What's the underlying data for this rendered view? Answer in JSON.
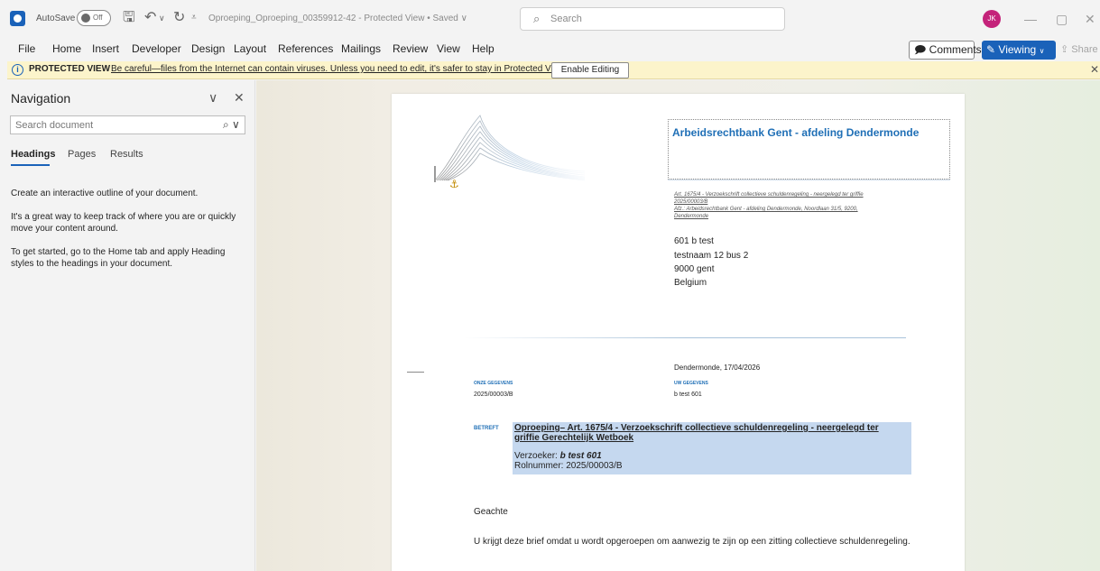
{
  "titlebar": {
    "autosave_label": "AutoSave",
    "autosave_state": "Off",
    "document_title": "Oproeping_Oproeping_00359912-42 - Protected View • Saved ∨",
    "search_placeholder": "Search",
    "user_initials": "JK"
  },
  "menu": {
    "items": [
      "File",
      "Home",
      "Insert",
      "Developer",
      "Design",
      "Layout",
      "References",
      "Mailings",
      "Review",
      "View",
      "Help"
    ],
    "comments_label": "Comments",
    "viewing_label": "Viewing",
    "share_label": "Share"
  },
  "protected_view": {
    "title": "PROTECTED VIEW",
    "message": "Be careful—files from the Internet can contain viruses. Unless you need to edit, it's safer to stay in Protected View.",
    "button_label": "Enable Editing"
  },
  "navigation": {
    "title": "Navigation",
    "search_placeholder": "Search document",
    "tabs": [
      "Headings",
      "Pages",
      "Results"
    ],
    "active_tab": "Headings",
    "paragraphs": [
      "Create an interactive outline of your document.",
      "It's a great way to keep track of where you are or quickly move your content around.",
      "To get started, go to the Home tab and apply Heading styles to the headings in your document."
    ]
  },
  "document": {
    "court_name": "Arbeidsrechtbank Gent - afdeling Dendermonde",
    "reference_lines": [
      "Art. 1675/4 - Verzoekschrift collectieve schuldenregeling - neergelegd ter griffie",
      "2025/00003/B",
      "Afz.: Arbeidsrechtbank Gent - afdeling Dendermonde, Noordlaan 31/5, 9200,",
      "Dendermonde"
    ],
    "address_lines": [
      "601 b test",
      "testnaam 12 bus 2",
      "9000 gent",
      "Belgium"
    ],
    "place_date": "Dendermonde, 17/04/2026",
    "onze_label": "ONZE GEGEVENS",
    "onze_value": "2025/00003/B",
    "uw_label": "UW GEGEVENS",
    "uw_value": "b test 601",
    "betreft_label": "BETREFT",
    "subject": "Oproeping– Art. 1675/4 - Verzoekschrift collectieve schuldenregeling - neergelegd ter griffie  Gerechtelijk Wetboek",
    "verzoeker_label": "Verzoeker: ",
    "verzoeker_value": "b test 601",
    "rolnummer": "Rolnummer: 2025/00003/B",
    "salutation": "Geachte",
    "body": "U krijgt deze brief omdat u wordt opgeroepen om aanwezig te zijn op een zitting collectieve schuldenregeling."
  },
  "colors": {
    "accent": "#1a62b9",
    "court_blue": "#1f6fb6",
    "highlight": "#c5d8ef",
    "protected_bar": "#fcf4cb",
    "avatar": "#c4237a"
  },
  "icons": {
    "app": "outlook-icon",
    "save": "save-icon",
    "undo": "undo-icon",
    "redo": "redo-icon",
    "search": "search-icon",
    "info": "info-icon",
    "close": "close-icon"
  }
}
